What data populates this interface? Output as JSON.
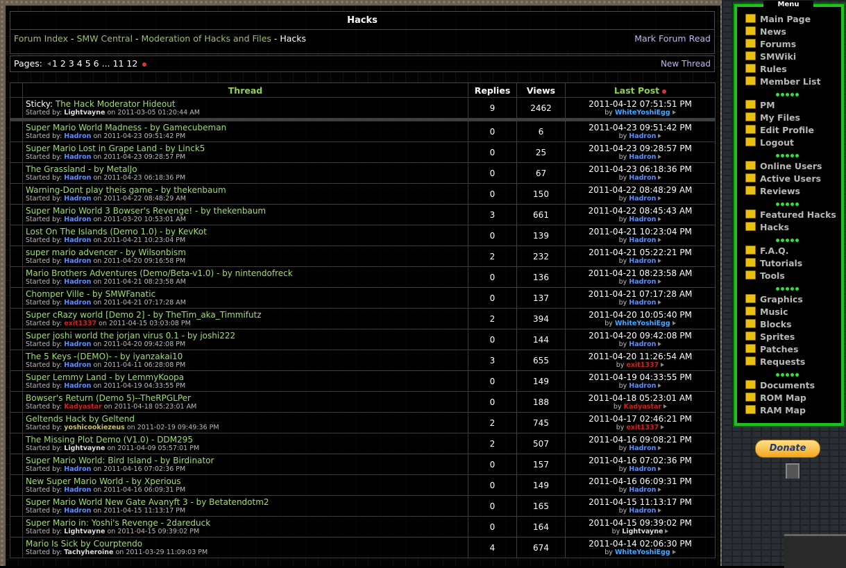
{
  "forum": {
    "title": "Hacks",
    "breadcrumb": [
      "Forum Index",
      "SMW Central",
      "Moderation of Hacks and Files",
      "Hacks"
    ],
    "breadcrumb_sep": " - ",
    "mark_read": "Mark Forum Read"
  },
  "pagination": {
    "label": "Pages:",
    "pages": [
      "1",
      "2",
      "3",
      "4",
      "5",
      "6",
      "...",
      "11",
      "12"
    ],
    "new_thread": "New Thread"
  },
  "table": {
    "headers": {
      "thread": "Thread",
      "replies": "Replies",
      "views": "Views",
      "last_post": "Last Post"
    },
    "started_by_label": "Started by:",
    "on_label": "on",
    "by_label": "by",
    "sticky_prefix": "Sticky:",
    "sticky": [
      {
        "title": "The Hack Moderator Hideout",
        "author": "Lightvayne",
        "author_color": "#dddddd",
        "started": "2011-03-05 01:20:44 AM",
        "replies": "9",
        "views": "2462",
        "last_date": "2011-04-12 07:51:51 PM",
        "last_by": "WhiteYoshiEgg",
        "last_color": "#47a8ff"
      }
    ],
    "rows": [
      {
        "title": "Super Mario World Madness - by Gamecubeman",
        "author": "Hadron",
        "author_color": "#5b8fff",
        "started": "2011-04-23 09:51:42 PM",
        "replies": "0",
        "views": "6",
        "last_date": "2011-04-23 09:51:42 PM",
        "last_by": "Hadron",
        "last_color": "#5b8fff"
      },
      {
        "title": "Super Mario Lost in Grape Land - by Linck5",
        "author": "Hadron",
        "author_color": "#5b8fff",
        "started": "2011-04-23 09:28:57 PM",
        "replies": "0",
        "views": "25",
        "last_date": "2011-04-23 09:28:57 PM",
        "last_by": "Hadron",
        "last_color": "#5b8fff"
      },
      {
        "title": "The Grassland - by MetalJo",
        "author": "Hadron",
        "author_color": "#5b8fff",
        "started": "2011-04-23 06:18:36 PM",
        "replies": "0",
        "views": "67",
        "last_date": "2011-04-23 06:18:36 PM",
        "last_by": "Hadron",
        "last_color": "#5b8fff"
      },
      {
        "title": "Warning-Dont play theis game - by thekenbaum",
        "author": "Hadron",
        "author_color": "#5b8fff",
        "started": "2011-04-22 08:48:29 AM",
        "replies": "0",
        "views": "150",
        "last_date": "2011-04-22 08:48:29 AM",
        "last_by": "Hadron",
        "last_color": "#5b8fff"
      },
      {
        "title": "Super Mario World 3 Bowser's Revenge! - by thekenbaum",
        "author": "Hadron",
        "author_color": "#5b8fff",
        "started": "2011-03-20 10:53:01 AM",
        "replies": "3",
        "views": "661",
        "last_date": "2011-04-22 08:45:43 AM",
        "last_by": "Hadron",
        "last_color": "#5b8fff"
      },
      {
        "title": "Lost On The Islands (Demo 1.0) - by KevKot",
        "author": "Hadron",
        "author_color": "#5b8fff",
        "started": "2011-04-21 10:23:04 PM",
        "replies": "0",
        "views": "139",
        "last_date": "2011-04-21 10:23:04 PM",
        "last_by": "Hadron",
        "last_color": "#5b8fff"
      },
      {
        "title": "super mario advencer - by Wilsonbism",
        "author": "Hadron",
        "author_color": "#5b8fff",
        "started": "2011-04-20 09:16:58 PM",
        "replies": "2",
        "views": "232",
        "last_date": "2011-04-21 05:22:21 PM",
        "last_by": "Hadron",
        "last_color": "#5b8fff"
      },
      {
        "title": "Mario Brothers Adventures (Demo/Beta-v1.0) - by nintendofreck",
        "author": "Hadron",
        "author_color": "#5b8fff",
        "started": "2011-04-21 08:23:58 AM",
        "replies": "0",
        "views": "136",
        "last_date": "2011-04-21 08:23:58 AM",
        "last_by": "Hadron",
        "last_color": "#5b8fff"
      },
      {
        "title": "Chomper Ville - by SMWFanatic",
        "author": "Hadron",
        "author_color": "#5b8fff",
        "started": "2011-04-21 07:17:28 AM",
        "replies": "0",
        "views": "137",
        "last_date": "2011-04-21 07:17:28 AM",
        "last_by": "Hadron",
        "last_color": "#5b8fff"
      },
      {
        "title": "Super cRazy world [Demo 2] - by TheTim_aka_Timmifutz",
        "author": "exit1337",
        "author_color": "#cc2222",
        "started": "2011-04-15 03:03:08 PM",
        "replies": "2",
        "views": "394",
        "last_date": "2011-04-20 10:05:40 PM",
        "last_by": "WhiteYoshiEgg",
        "last_color": "#47a8ff"
      },
      {
        "title": "Super joshi world the jorjan virus 0.1 - by joshi222",
        "author": "Hadron",
        "author_color": "#5b8fff",
        "started": "2011-04-20 09:42:08 PM",
        "replies": "0",
        "views": "144",
        "last_date": "2011-04-20 09:42:08 PM",
        "last_by": "Hadron",
        "last_color": "#5b8fff"
      },
      {
        "title": "The 5 Keys -(DEMO)- - by iyanzakai10",
        "author": "Hadron",
        "author_color": "#5b8fff",
        "started": "2011-04-11 06:28:08 PM",
        "replies": "3",
        "views": "655",
        "last_date": "2011-04-20 11:26:54 AM",
        "last_by": "exit1337",
        "last_color": "#cc2222"
      },
      {
        "title": "Super Lemmy Land - by LemmyKoopa",
        "author": "Hadron",
        "author_color": "#5b8fff",
        "started": "2011-04-19 04:33:55 PM",
        "replies": "0",
        "views": "149",
        "last_date": "2011-04-19 04:33:55 PM",
        "last_by": "Hadron",
        "last_color": "#5b8fff"
      },
      {
        "title": "Bowser's Return (Demo 5)--TheRPGLPer",
        "author": "Kadyastar",
        "author_color": "#cc2222",
        "started": "2011-04-18 05:23:01 AM",
        "replies": "0",
        "views": "188",
        "last_date": "2011-04-18 05:23:01 AM",
        "last_by": "Kadyastar",
        "last_color": "#cc2222"
      },
      {
        "title": "Geltends Hack by Geltend",
        "author": "yoshicookiezeus",
        "author_color": "#c9c36a",
        "started": "2011-02-19 09:49:36 PM",
        "replies": "2",
        "views": "745",
        "last_date": "2011-04-17 02:46:21 PM",
        "last_by": "exit1337",
        "last_color": "#cc2222"
      },
      {
        "title": "The Missing Plot Demo (V1.0) - DDM295",
        "author": "Lightvayne",
        "author_color": "#dddddd",
        "started": "2011-04-09 05:57:01 PM",
        "replies": "2",
        "views": "507",
        "last_date": "2011-04-16 09:08:21 PM",
        "last_by": "Hadron",
        "last_color": "#5b8fff"
      },
      {
        "title": "Super Mario World: Bird Island - by Birdinator",
        "author": "Hadron",
        "author_color": "#5b8fff",
        "started": "2011-04-16 07:02:36 PM",
        "replies": "0",
        "views": "157",
        "last_date": "2011-04-16 07:02:36 PM",
        "last_by": "Hadron",
        "last_color": "#5b8fff"
      },
      {
        "title": "New Super Mario World - by Xperious",
        "author": "Hadron",
        "author_color": "#5b8fff",
        "started": "2011-04-16 06:09:31 PM",
        "replies": "0",
        "views": "149",
        "last_date": "2011-04-16 06:09:31 PM",
        "last_by": "Hadron",
        "last_color": "#5b8fff"
      },
      {
        "title": "Super Mario World New Gate Avanyft 3 - by Betatendotm2",
        "author": "Hadron",
        "author_color": "#5b8fff",
        "started": "2011-04-15 11:13:17 PM",
        "replies": "0",
        "views": "165",
        "last_date": "2011-04-15 11:13:17 PM",
        "last_by": "Hadron",
        "last_color": "#5b8fff"
      },
      {
        "title": "Super Mario in: Yoshi's Revenge - 2dareduck",
        "author": "Lightvayne",
        "author_color": "#dddddd",
        "started": "2011-04-15 09:39:02 PM",
        "replies": "0",
        "views": "164",
        "last_date": "2011-04-15 09:39:02 PM",
        "last_by": "Lightvayne",
        "last_color": "#dddddd"
      },
      {
        "title": "Mario Is Sick by Courptendo",
        "author": "Tachyheroine",
        "author_color": "#dddddd",
        "started": "2011-03-29 11:09:03 PM",
        "replies": "4",
        "views": "674",
        "last_date": "2011-04-14 02:06:30 PM",
        "last_by": "WhiteYoshiEgg",
        "last_color": "#47a8ff"
      }
    ]
  },
  "sidebar": {
    "menu_title": "Menu",
    "groups": [
      [
        "Main Page",
        "News",
        "Forums",
        "SMWiki",
        "Rules",
        "Member List"
      ],
      [
        "PM",
        "My Files",
        "Edit Profile",
        "Logout"
      ],
      [
        "Online Users",
        "Active Users",
        "Reviews"
      ],
      [
        "Featured Hacks",
        "Hacks"
      ],
      [
        "F.A.Q.",
        "Tutorials",
        "Tools"
      ],
      [
        "Graphics",
        "Music",
        "Blocks",
        "Sprites",
        "Patches",
        "Requests"
      ],
      [
        "Documents",
        "ROM Map",
        "RAM Map"
      ]
    ],
    "item_icon": "yellow-page-icon",
    "donate_label": "Donate"
  }
}
